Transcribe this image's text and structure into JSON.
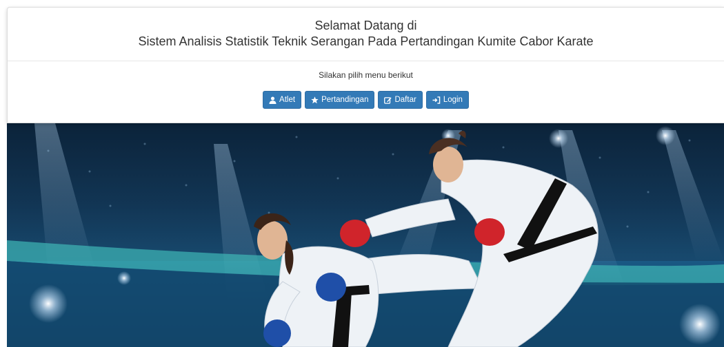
{
  "header": {
    "title_line1": "Selamat Datang di",
    "title_line2": "Sistem Analisis Statistik Teknik Serangan Pada Pertandingan Kumite Cabor Karate"
  },
  "body": {
    "subtitle": "Silakan pilih menu berikut",
    "buttons": [
      {
        "label": "Atlet",
        "icon": "user-icon"
      },
      {
        "label": "Pertandingan",
        "icon": "star-icon"
      },
      {
        "label": "Daftar",
        "icon": "edit-icon"
      },
      {
        "label": "Login",
        "icon": "login-icon"
      }
    ]
  },
  "colors": {
    "primary": "#337ab7",
    "primary_border": "#2e6da4"
  },
  "hero": {
    "image_subject": "karate-kumite-stadium-photo"
  }
}
